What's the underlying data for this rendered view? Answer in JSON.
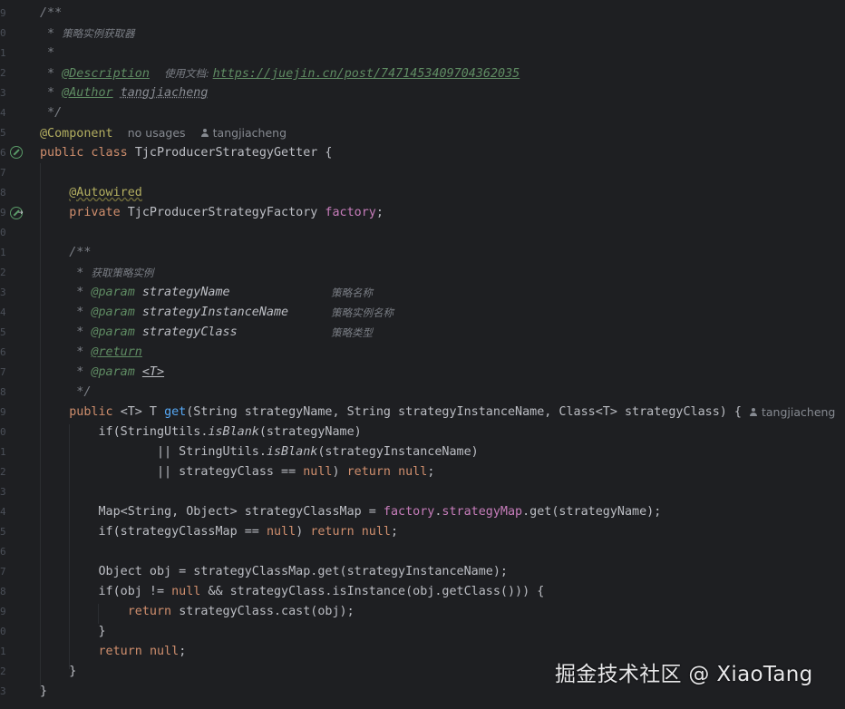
{
  "gutter": {
    "line_numbers": [
      "9",
      "0",
      "1",
      "2",
      "3",
      "4",
      "5",
      "6",
      "7",
      "8",
      "9",
      "0",
      "1",
      "2",
      "3",
      "4",
      "5",
      "6",
      "7",
      "8",
      "9",
      "0",
      "1",
      "2",
      "3",
      "4",
      "5",
      "6",
      "7",
      "8",
      "9",
      "0",
      "1",
      "2",
      "3"
    ]
  },
  "code": {
    "l1": "/**",
    "l2_prefix": " * ",
    "l2_text": "策略实例获取器",
    "l3": " *",
    "l4_prefix": " * ",
    "l4_tag": "@Description",
    "l4_label": "使用文档: ",
    "l4_url": "https://juejin.cn/post/7471453409704362035",
    "l5_prefix": " * ",
    "l5_tag": "@Author",
    "l5_value": "tangjiacheng",
    "l6": " */",
    "l7_annotation": "@Component",
    "l7_usages": "no usages",
    "l7_author": "tangjiacheng",
    "l8_kw": "public class ",
    "l8_name": "TjcProducerStrategyGetter {",
    "l10_annotation": "@Autowired",
    "l11_kw": "private ",
    "l11_type": "TjcProducerStrategyFactory ",
    "l11_field": "factory",
    "l11_end": ";",
    "l13": "/**",
    "l14_prefix": " * ",
    "l14_text": "获取策略实例",
    "l15_tag": "@param",
    "l15_name": "strategyName",
    "l15_desc": "策略名称",
    "l16_tag": "@param",
    "l16_name": "strategyInstanceName",
    "l16_desc": "策略实例名称",
    "l17_tag": "@param",
    "l17_name": "strategyClass",
    "l17_desc": "策略类型",
    "l18_tag": "@return",
    "l19_tag": "@param",
    "l19_name": "<T>",
    "l20": " */",
    "l21_kw": "public ",
    "l21_generic": "<T> T ",
    "l21_fn": "get",
    "l21_params": "(String strategyName, String strategyInstanceName, Class<T> strategyClass) {",
    "l21_author": "tangjiacheng",
    "l22_a": "if(StringUtils.",
    "l22_m": "isBlank",
    "l22_b": "(strategyName)",
    "l23_a": "|| StringUtils.",
    "l23_m": "isBlank",
    "l23_b": "(strategyInstanceName)",
    "l24_a": "|| strategyClass == ",
    "l24_null": "null",
    "l24_b": ") ",
    "l24_ret": "return ",
    "l24_null2": "null",
    "l24_end": ";",
    "l26_a": "Map<String, Object> strategyClassMap = ",
    "l26_f1": "factory",
    "l26_dot": ".",
    "l26_f2": "strategyMap",
    "l26_b": ".get(strategyName);",
    "l27_a": "if(strategyClassMap == ",
    "l27_null": "null",
    "l27_b": ") ",
    "l27_ret": "return ",
    "l27_null2": "null",
    "l27_end": ";",
    "l29": "Object obj = strategyClassMap.get(strategyInstanceName);",
    "l30_a": "if(obj != ",
    "l30_null": "null",
    "l30_b": " && strategyClass.isInstance(obj.getClass())) {",
    "l31_ret": "return ",
    "l31_b": "strategyClass.cast(obj);",
    "l32": "}",
    "l33_ret": "return ",
    "l33_null": "null",
    "l33_end": ";",
    "l34": "}",
    "l35": "}"
  },
  "watermark": "掘金技术社区 @ XiaoTang",
  "icons": [
    "spring-bean-icon",
    "autowired-injection-icon",
    "user-icon"
  ]
}
